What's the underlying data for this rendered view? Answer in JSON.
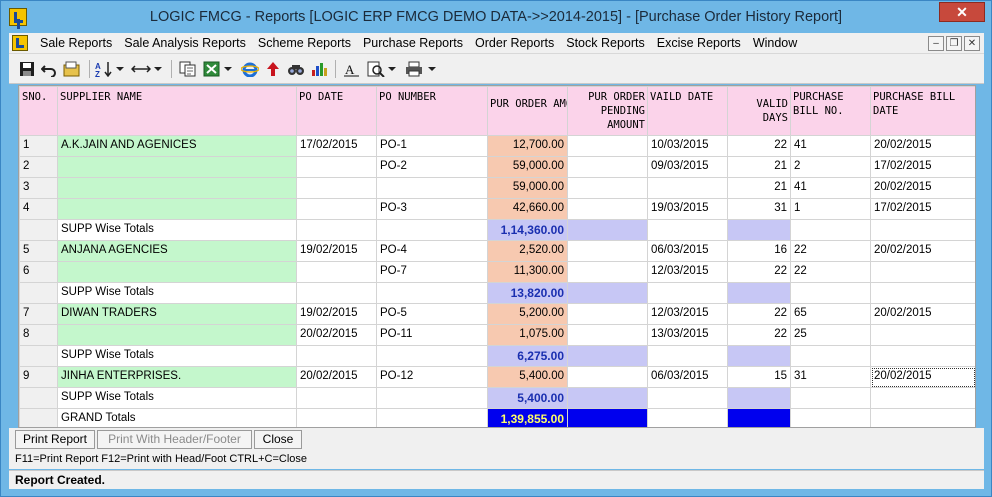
{
  "window": {
    "title": "LOGIC FMCG - Reports  [LOGIC ERP FMCG DEMO DATA->>2014-2015] - [Purchase Order History Report]",
    "close_label": "✕"
  },
  "menu": {
    "items": [
      "Sale Reports",
      "Sale Analysis Reports",
      "Scheme Reports",
      "Purchase Reports",
      "Order Reports",
      "Stock Reports",
      "Excise Reports",
      "Window"
    ]
  },
  "mdi": {
    "minimize": "–",
    "restore": "❐",
    "close": "✕"
  },
  "toolbar": {
    "icons": [
      "save-icon",
      "undo-icon",
      "folder-icon",
      "sort-icon",
      "dropdown-arrow-icon",
      "column-width-icon",
      "dropdown-arrow-icon",
      "copy-icon",
      "excel-icon",
      "dropdown-arrow-icon",
      "internet-explorer-icon",
      "up-arrow-icon",
      "find-icon",
      "chart-icon",
      "font-icon",
      "print-preview-icon",
      "dropdown-arrow-icon",
      "print-icon",
      "dropdown-arrow-icon"
    ]
  },
  "grid": {
    "headers": {
      "sno": "SNO.",
      "supplier": "SUPPLIER NAME",
      "po_date": "PO DATE",
      "po_number": "PO NUMBER",
      "pur_order_amount": "PUR ORDER AMOUNT",
      "pending_amount": "PUR ORDER PENDING AMOUNT",
      "valid_date": "VAILD DATE",
      "valid_days": "VALID DAYS",
      "bill_no": "PURCHASE BILL NO.",
      "bill_date": "PURCHASE BILL DATE"
    },
    "rows": [
      {
        "type": "data",
        "sno": "1",
        "supplier": "A.K.JAIN AND AGENICES",
        "po_date": "17/02/2015",
        "po_number": "PO-1",
        "amount": "12,700.00",
        "pending": "",
        "valid_date": "10/03/2015",
        "valid_days": "22",
        "bill_no": "41",
        "bill_date": "20/02/2015"
      },
      {
        "type": "data",
        "sno": "2",
        "supplier": "",
        "po_date": "",
        "po_number": "PO-2",
        "amount": "59,000.00",
        "pending": "",
        "valid_date": "09/03/2015",
        "valid_days": "21",
        "bill_no": "2",
        "bill_date": "17/02/2015"
      },
      {
        "type": "data",
        "sno": "3",
        "supplier": "",
        "po_date": "",
        "po_number": "",
        "amount": "59,000.00",
        "pending": "",
        "valid_date": "",
        "valid_days": "21",
        "bill_no": "41",
        "bill_date": "20/02/2015"
      },
      {
        "type": "data",
        "sno": "4",
        "supplier": "",
        "po_date": "",
        "po_number": "PO-3",
        "amount": "42,660.00",
        "pending": "",
        "valid_date": "19/03/2015",
        "valid_days": "31",
        "bill_no": "1",
        "bill_date": "17/02/2015"
      },
      {
        "type": "total",
        "label": "SUPP Wise Totals",
        "amount": "1,14,360.00"
      },
      {
        "type": "data",
        "sno": "5",
        "supplier": "ANJANA AGENCIES",
        "po_date": "19/02/2015",
        "po_number": "PO-4",
        "amount": "2,520.00",
        "pending": "",
        "valid_date": "06/03/2015",
        "valid_days": "16",
        "bill_no": "22",
        "bill_date": "20/02/2015"
      },
      {
        "type": "data",
        "sno": "6",
        "supplier": "",
        "po_date": "",
        "po_number": "PO-7",
        "amount": "11,300.00",
        "pending": "",
        "valid_date": "12/03/2015",
        "valid_days": "22",
        "bill_no": "22",
        "bill_date": ""
      },
      {
        "type": "total",
        "label": "SUPP Wise Totals",
        "amount": "13,820.00"
      },
      {
        "type": "data",
        "sno": "7",
        "supplier": "DIWAN TRADERS",
        "po_date": "19/02/2015",
        "po_number": "PO-5",
        "amount": "5,200.00",
        "pending": "",
        "valid_date": "12/03/2015",
        "valid_days": "22",
        "bill_no": "65",
        "bill_date": "20/02/2015"
      },
      {
        "type": "data",
        "sno": "8",
        "supplier": "",
        "po_date": "20/02/2015",
        "po_number": "PO-11",
        "amount": "1,075.00",
        "pending": "",
        "valid_date": "13/03/2015",
        "valid_days": "22",
        "bill_no": "25",
        "bill_date": ""
      },
      {
        "type": "total",
        "label": "SUPP Wise Totals",
        "amount": "6,275.00"
      },
      {
        "type": "data",
        "sno": "9",
        "supplier": "JINHA ENTERPRISES.",
        "po_date": "20/02/2015",
        "po_number": "PO-12",
        "amount": "5,400.00",
        "pending": "",
        "valid_date": "06/03/2015",
        "valid_days": "15",
        "bill_no": "31",
        "bill_date": "20/02/2015"
      },
      {
        "type": "total",
        "label": "SUPP Wise Totals",
        "amount": "5,400.00"
      },
      {
        "type": "grand",
        "label": "GRAND Totals",
        "amount": "1,39,855.00"
      }
    ]
  },
  "buttons": {
    "print_report": "Print Report",
    "print_header_footer": "Print With Header/Footer",
    "close": "Close"
  },
  "hint": "F11=Print Report  F12=Print with Head/Foot  CTRL+C=Close",
  "status": "Report Created."
}
